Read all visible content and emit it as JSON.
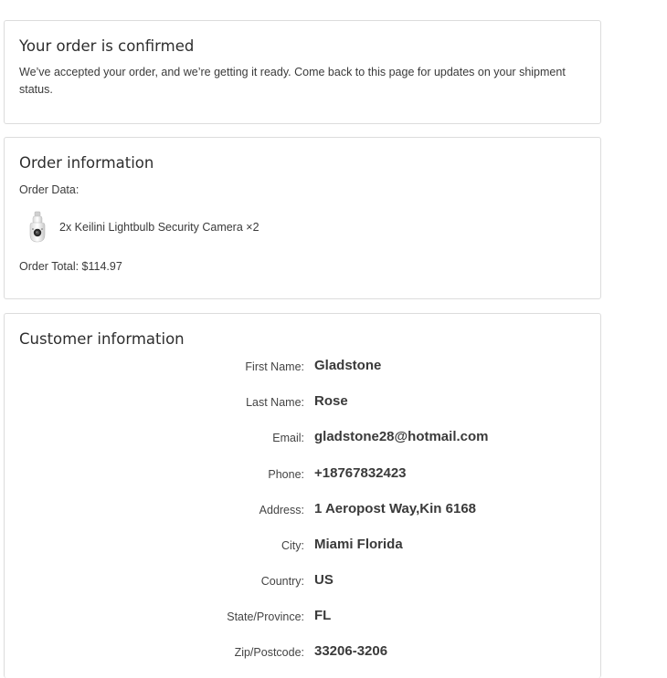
{
  "confirmation": {
    "title": "Your order is confirmed",
    "message": "We’ve accepted your order, and we’re getting it ready. Come back to this page for updates on your shipment status."
  },
  "order": {
    "title": "Order information",
    "data_label": "Order Data:",
    "items": [
      {
        "name": "2x Keilini Lightbulb Security Camera ×2",
        "icon": "lightbulb-camera-icon"
      }
    ],
    "total_text": "Order Total: $114.97"
  },
  "customer": {
    "title": "Customer information",
    "fields": [
      {
        "label": "First Name:",
        "value": "Gladstone"
      },
      {
        "label": "Last Name:",
        "value": "Rose"
      },
      {
        "label": "Email:",
        "value": "gladstone28@hotmail.com"
      },
      {
        "label": "Phone:",
        "value": "+18767832423"
      },
      {
        "label": "Address:",
        "value": "1 Aeropost Way,Kin 6168"
      },
      {
        "label": "City:",
        "value": "Miami Florida"
      },
      {
        "label": "Country:",
        "value": "US"
      },
      {
        "label": "State/Province:",
        "value": "FL"
      },
      {
        "label": "Zip/Postcode:",
        "value": "33206-3206"
      }
    ]
  }
}
